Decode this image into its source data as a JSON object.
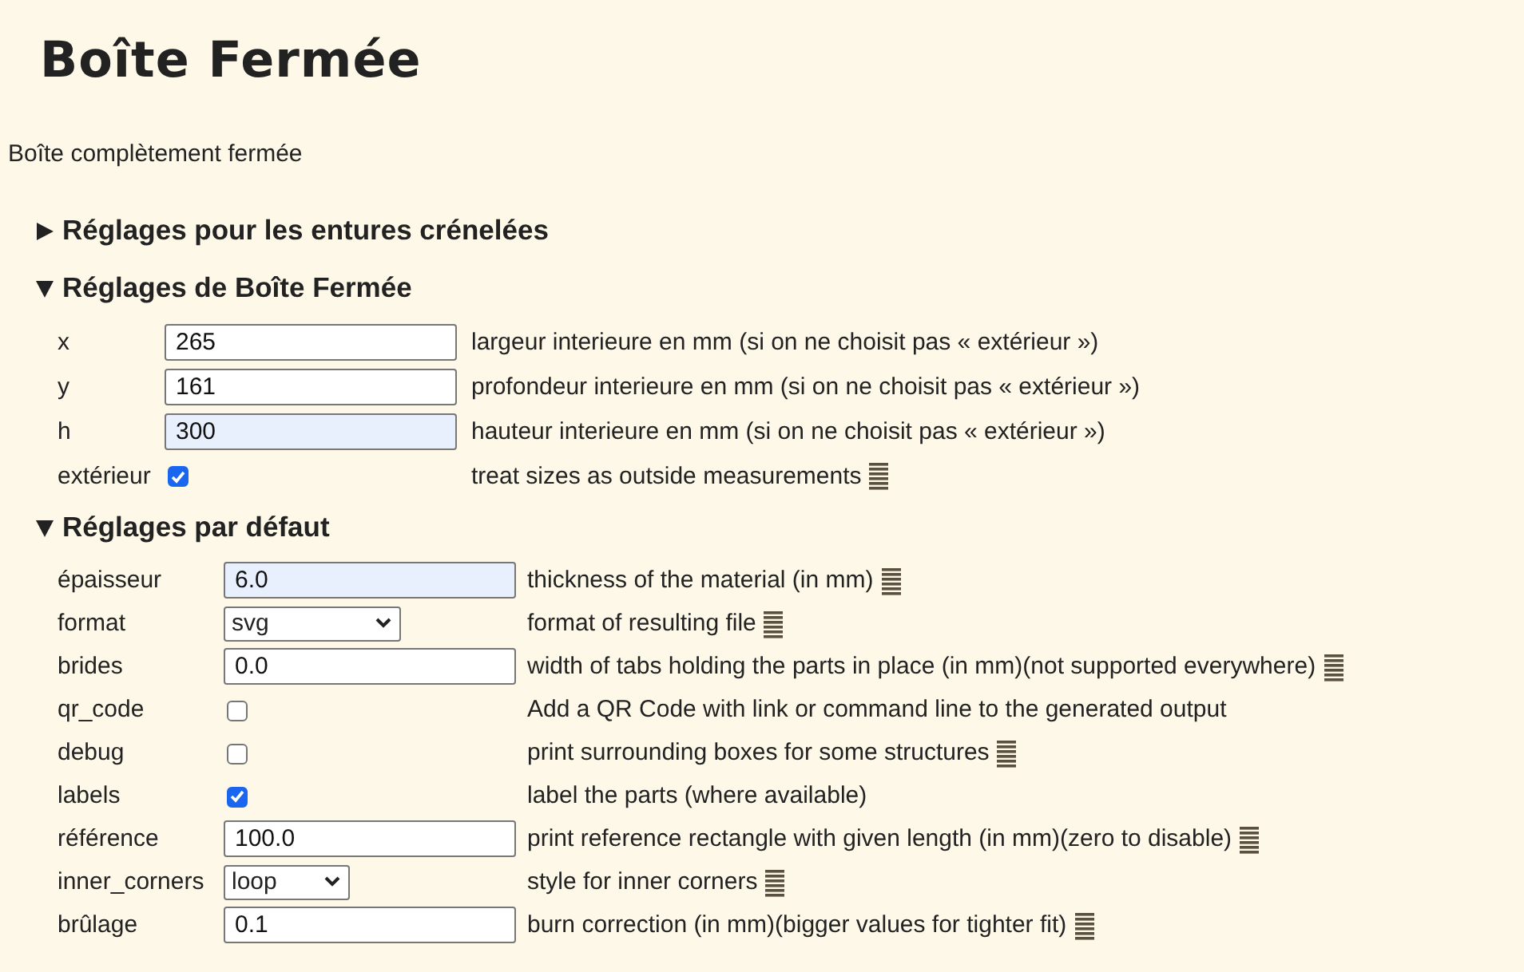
{
  "title": "Boîte Fermée",
  "description": "Boîte complètement fermée",
  "sections": [
    {
      "heading": "Réglages pour les entures crénelées",
      "expanded": false
    },
    {
      "heading": "Réglages de Boîte Fermée",
      "expanded": true,
      "rows": [
        {
          "label": "x",
          "kind": "text",
          "value": "265",
          "autofilled": false,
          "help_text": "largeur interieure en mm (si on ne choisit pas « extérieur »)",
          "help": false
        },
        {
          "label": "y",
          "kind": "text",
          "value": "161",
          "autofilled": false,
          "help_text": "profondeur interieure en mm (si on ne choisit pas « extérieur »)",
          "help": false
        },
        {
          "label": "h",
          "kind": "text",
          "value": "300",
          "autofilled": true,
          "help_text": "hauteur interieure en mm (si on ne choisit pas « extérieur »)",
          "help": false
        },
        {
          "label": "extérieur",
          "kind": "checkbox",
          "checked": true,
          "help_text": "treat sizes as outside measurements",
          "help": true
        }
      ]
    },
    {
      "heading": "Réglages par défaut",
      "expanded": true,
      "rows": [
        {
          "label": "épaisseur",
          "kind": "text",
          "value": "6.0",
          "autofilled": true,
          "help_text": "thickness of the material (in mm)",
          "help": true
        },
        {
          "label": "format",
          "kind": "select",
          "value": "svg",
          "help_text": "format of resulting file",
          "help": true
        },
        {
          "label": "brides",
          "kind": "text",
          "value": "0.0",
          "autofilled": false,
          "help_text": "width of tabs holding the parts in place (in mm)(not supported everywhere)",
          "help": true
        },
        {
          "label": "qr_code",
          "kind": "checkbox",
          "checked": false,
          "help_text": "Add a QR Code with link or command line to the generated output",
          "help": false
        },
        {
          "label": "debug",
          "kind": "checkbox",
          "checked": false,
          "help_text": "print surrounding boxes for some structures",
          "help": true
        },
        {
          "label": "labels",
          "kind": "checkbox",
          "checked": true,
          "help_text": "label the parts (where available)",
          "help": false
        },
        {
          "label": "référence",
          "kind": "text",
          "value": "100.0",
          "autofilled": false,
          "help_text": "print reference rectangle with given length (in mm)(zero to disable)",
          "help": true
        },
        {
          "label": "inner_corners",
          "kind": "select",
          "value": "loop",
          "help_text": "style for inner corners",
          "help": true
        },
        {
          "label": "brûlage",
          "kind": "text",
          "value": "0.1",
          "autofilled": false,
          "help_text": "burn correction (in mm)(bigger values for tighter fit)",
          "help": true
        }
      ]
    }
  ]
}
